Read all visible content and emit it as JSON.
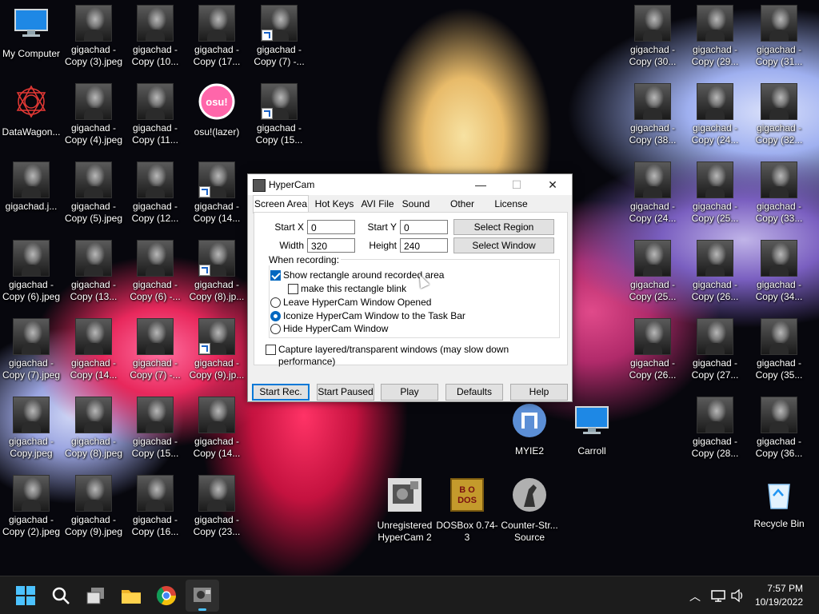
{
  "desktop": {
    "icons": [
      {
        "label": "My Computer",
        "kind": "monitor",
        "shortcut": false
      },
      {
        "label": "gigachad - Copy (3).jpeg",
        "kind": "photo",
        "shortcut": false
      },
      {
        "label": "gigachad - Copy (10...",
        "kind": "photo",
        "shortcut": false
      },
      {
        "label": "gigachad - Copy (17...",
        "kind": "photo",
        "shortcut": false
      },
      {
        "label": "gigachad - Copy (7) -...",
        "kind": "photo",
        "shortcut": true
      },
      {
        "label": "DataWagon...",
        "kind": "datawagon",
        "shortcut": true
      },
      {
        "label": "gigachad - Copy (4).jpeg",
        "kind": "photo",
        "shortcut": false
      },
      {
        "label": "gigachad - Copy (11...",
        "kind": "photo",
        "shortcut": false
      },
      {
        "label": "osu!(lazer)",
        "kind": "osu",
        "shortcut": false
      },
      {
        "label": "gigachad - Copy (15...",
        "kind": "photo",
        "shortcut": true
      },
      {
        "label": "gigachad.j...",
        "kind": "photo",
        "shortcut": false
      },
      {
        "label": "gigachad - Copy (5).jpeg",
        "kind": "photo",
        "shortcut": false
      },
      {
        "label": "gigachad - Copy (12...",
        "kind": "photo",
        "shortcut": false
      },
      {
        "label": "gigachad - Copy (14...",
        "kind": "photo",
        "shortcut": true
      },
      {
        "label": "gigachad - Copy (6).jpeg",
        "kind": "photo",
        "shortcut": false
      },
      {
        "label": "gigachad - Copy (13...",
        "kind": "photo",
        "shortcut": false
      },
      {
        "label": "gigachad - Copy (6) -...",
        "kind": "photo",
        "shortcut": false
      },
      {
        "label": "gigachad - Copy (8).jp...",
        "kind": "photo",
        "shortcut": true
      },
      {
        "label": "gigachad - Copy (7).jpeg",
        "kind": "photo",
        "shortcut": false
      },
      {
        "label": "gigachad - Copy (14...",
        "kind": "photo",
        "shortcut": false
      },
      {
        "label": "gigachad - Copy (7) -...",
        "kind": "photo",
        "shortcut": false
      },
      {
        "label": "gigachad - Copy (9).jp...",
        "kind": "photo",
        "shortcut": true
      },
      {
        "label": "gigachad - Copy.jpeg",
        "kind": "photo",
        "shortcut": false
      },
      {
        "label": "gigachad - Copy (8).jpeg",
        "kind": "photo",
        "shortcut": false
      },
      {
        "label": "gigachad - Copy (15...",
        "kind": "photo",
        "shortcut": false
      },
      {
        "label": "gigachad - Copy (14...",
        "kind": "photo",
        "shortcut": false
      },
      {
        "label": "gigachad - Copy (2).jpeg",
        "kind": "photo",
        "shortcut": false
      },
      {
        "label": "gigachad - Copy (9).jpeg",
        "kind": "photo",
        "shortcut": false
      },
      {
        "label": "gigachad - Copy (16...",
        "kind": "photo",
        "shortcut": false
      },
      {
        "label": "gigachad - Copy (23...",
        "kind": "photo",
        "shortcut": false
      },
      {
        "label": "gigachad - Copy (30...",
        "kind": "photo",
        "shortcut": false
      },
      {
        "label": "gigachad - Copy (29...",
        "kind": "photo",
        "shortcut": false
      },
      {
        "label": "gigachad - Copy (31...",
        "kind": "photo",
        "shortcut": false
      },
      {
        "label": "gigachad - Copy (38...",
        "kind": "photo",
        "shortcut": false
      },
      {
        "label": "gigachad - Copy (24...",
        "kind": "photo",
        "shortcut": false
      },
      {
        "label": "gigachad - Copy (32...",
        "kind": "photo",
        "shortcut": false
      },
      {
        "label": "gigachad - Copy (24...",
        "kind": "photo",
        "shortcut": false
      },
      {
        "label": "gigachad - Copy (25...",
        "kind": "photo",
        "shortcut": false
      },
      {
        "label": "gigachad - Copy (33...",
        "kind": "photo",
        "shortcut": false
      },
      {
        "label": "gigachad - Copy (25...",
        "kind": "photo",
        "shortcut": false
      },
      {
        "label": "gigachad - Copy (26...",
        "kind": "photo",
        "shortcut": false
      },
      {
        "label": "gigachad - Copy (34...",
        "kind": "photo",
        "shortcut": false
      },
      {
        "label": "gigachad - Copy (26...",
        "kind": "photo",
        "shortcut": false
      },
      {
        "label": "gigachad - Copy (27...",
        "kind": "photo",
        "shortcut": false
      },
      {
        "label": "gigachad - Copy (35...",
        "kind": "photo",
        "shortcut": false
      },
      {
        "label": "gigachad - Copy (28...",
        "kind": "photo",
        "shortcut": false
      },
      {
        "label": "gigachad - Copy (36...",
        "kind": "photo",
        "shortcut": false
      },
      {
        "label": "Recycle Bin",
        "kind": "recycle",
        "shortcut": false
      },
      {
        "label": "MYIE2",
        "kind": "myie",
        "shortcut": true
      },
      {
        "label": "Carroll",
        "kind": "monitor",
        "shortcut": true
      },
      {
        "label": "Unregistered HyperCam 2",
        "kind": "hypercam",
        "shortcut": true
      },
      {
        "label": "DOSBox 0.74-3",
        "kind": "dosbox",
        "shortcut": true
      },
      {
        "label": "Counter-Str... Source",
        "kind": "cs",
        "shortcut": true
      }
    ]
  },
  "hypercam": {
    "title": "HyperCam",
    "controls": {
      "minimize": "—",
      "maximize": "☐",
      "close": "✕"
    },
    "tabs": [
      "Screen Area",
      "Hot Keys",
      "AVI File",
      "Sound",
      "Other Options",
      "License"
    ],
    "active_tab": "Screen Area",
    "start_x_label": "Start X",
    "start_x_value": "0",
    "start_y_label": "Start Y",
    "start_y_value": "0",
    "width_label": "Width",
    "width_value": "320",
    "height_label": "Height",
    "height_value": "240",
    "select_region": "Select Region",
    "select_window": "Select Window",
    "when_recording": "When recording:",
    "show_rect": {
      "label": "Show rectangle around recorded area",
      "checked": true
    },
    "blink": {
      "label": "make this rectangle blink",
      "checked": false
    },
    "radio_options": [
      {
        "label": "Leave HyperCam Window Opened",
        "selected": false
      },
      {
        "label": "Iconize HyperCam Window to the Task Bar",
        "selected": true
      },
      {
        "label": "Hide HyperCam Window",
        "selected": false
      }
    ],
    "capture_layered": {
      "label": "Capture layered/transparent windows (may slow down performance)",
      "checked": false
    },
    "buttons": [
      "Start Rec.",
      "Start Paused",
      "Play",
      "Defaults",
      "Help"
    ]
  },
  "taskbar": {
    "apps": [
      "start-icon",
      "search-icon",
      "task-view-icon",
      "file-explorer-icon",
      "chrome-icon",
      "hypercam-icon"
    ],
    "time": "7:57 PM",
    "date": "10/19/2022",
    "tray": [
      "chevron-up-icon",
      "network-icon",
      "volume-icon"
    ]
  },
  "colors": {
    "accent": "#0067c0",
    "taskbar": "#1c1c1c"
  }
}
